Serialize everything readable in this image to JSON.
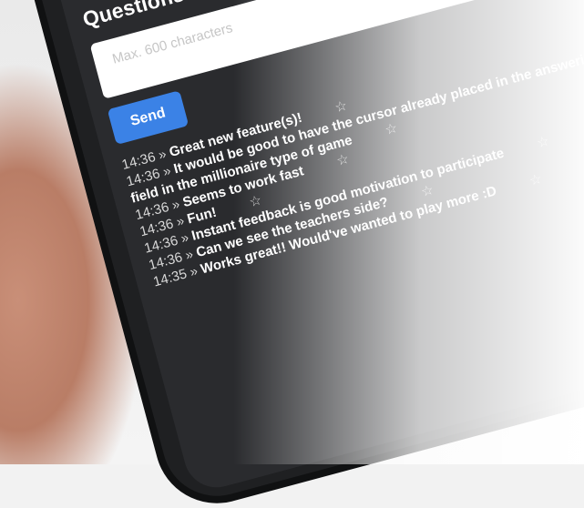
{
  "heading": "Questions or comments",
  "input": {
    "placeholder": "Max. 600 characters"
  },
  "send_label": "Send",
  "messages": [
    {
      "time": "14:36",
      "sep": "»",
      "text": "Great new feature(s)!",
      "star": "☆"
    },
    {
      "time": "14:36",
      "sep": "»",
      "text": "It would be good to have the cursor already placed in the answering field in the millionaire type of game",
      "star": "☆"
    },
    {
      "time": "14:36",
      "sep": "»",
      "text": "Seems to work fast",
      "star": "☆"
    },
    {
      "time": "14:36",
      "sep": "»",
      "text": "Fun!",
      "star": "☆"
    },
    {
      "time": "14:36",
      "sep": "»",
      "text": "Instant feedback is good motivation to participate",
      "star": "☆"
    },
    {
      "time": "14:36",
      "sep": "»",
      "text": "Can we see the teachers side?",
      "star": "☆"
    },
    {
      "time": "14:35",
      "sep": "»",
      "text": "Works great!! Would've wanted to play more :D",
      "star": "☆"
    }
  ],
  "colors": {
    "send_button": "#3b82e6",
    "screen": "#2a2b2e",
    "highlight_star": "#e05555"
  }
}
